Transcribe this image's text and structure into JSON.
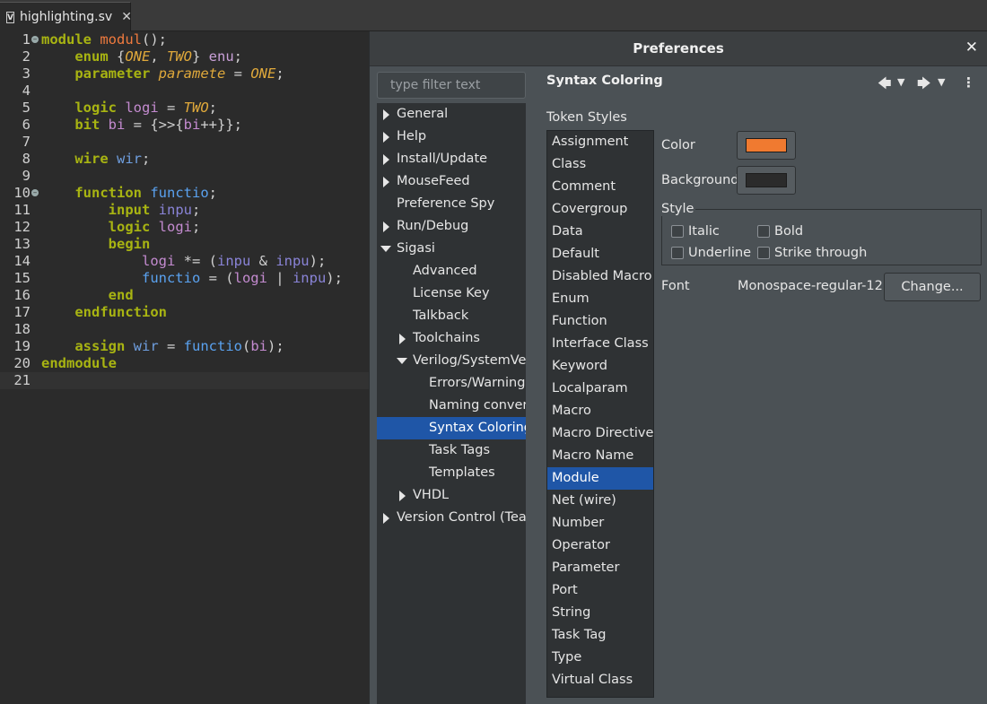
{
  "editor_tab": {
    "label": "highlighting.sv",
    "icon": "V"
  },
  "editor_lines": [
    "1",
    "2",
    "3",
    "4",
    "5",
    "6",
    "7",
    "8",
    "9",
    "10",
    "11",
    "12",
    "13",
    "14",
    "15",
    "16",
    "17",
    "18",
    "19",
    "20",
    "21"
  ],
  "dialog": {
    "title": "Preferences",
    "filter_placeholder": "type filter text",
    "page_title": "Syntax Coloring",
    "token_styles_label": "Token Styles",
    "color_label": "Color",
    "background_label": "Background",
    "style_label": "Style",
    "italic_label": "Italic",
    "bold_label": "Bold",
    "underline_label": "Underline",
    "strike_label": "Strike through",
    "font_label": "Font",
    "font_value": "Monospace-regular-12",
    "change_label": "Change...",
    "color_value": "#f07a30",
    "background_value": "#2b2b2b"
  },
  "tree": [
    "General",
    "Help",
    "Install/Update",
    "MouseFeed",
    "Preference Spy",
    "Run/Debug",
    "Sigasi",
    "Advanced",
    "License Key",
    "Talkback",
    "Toolchains",
    "Verilog/SystemVerilog",
    "Errors/Warnings",
    "Naming conventions",
    "Syntax Coloring",
    "Task Tags",
    "Templates",
    "VHDL",
    "Version Control (Team)"
  ],
  "tokens": [
    "Assignment",
    "Class",
    "Comment",
    "Covergroup",
    "Data",
    "Default",
    "Disabled Macro",
    "Enum",
    "Function",
    "Interface Class",
    "Keyword",
    "Localparam",
    "Macro",
    "Macro Directive",
    "Macro Name",
    "Module",
    "Net (wire)",
    "Number",
    "Operator",
    "Parameter",
    "Port",
    "String",
    "Task Tag",
    "Type",
    "Virtual Class"
  ]
}
